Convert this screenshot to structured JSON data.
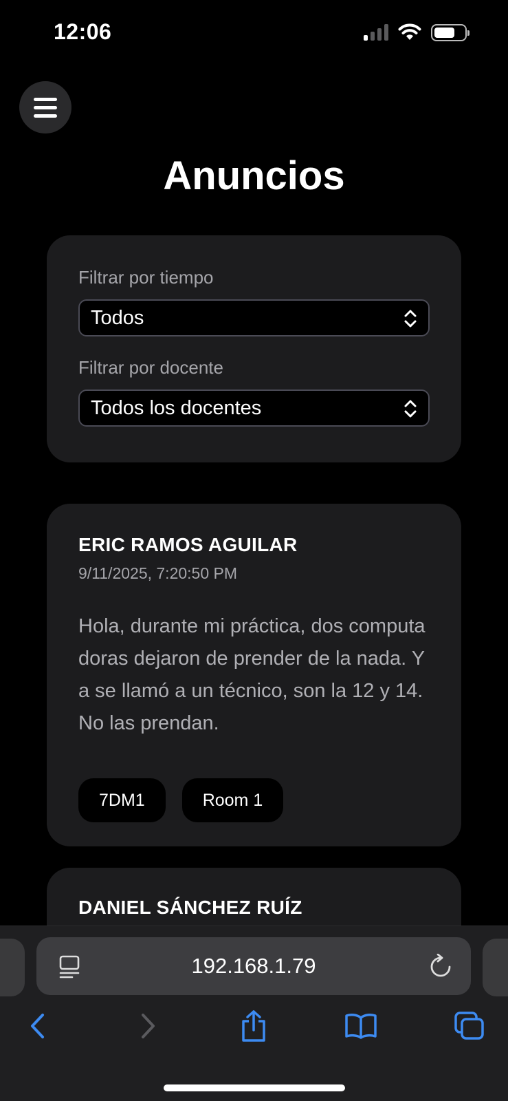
{
  "status_bar": {
    "time": "12:06"
  },
  "page": {
    "title": "Anuncios"
  },
  "filters": {
    "time_label": "Filtrar por tiempo",
    "time_value": "Todos",
    "teacher_label": "Filtrar por docente",
    "teacher_value": "Todos los docentes"
  },
  "announcements": [
    {
      "author": "ERIC RAMOS AGUILAR",
      "date": "9/11/2025, 7:20:50 PM",
      "message": "Hola, durante mi práctica, dos computadoras dejaron de prender de la nada. Ya se llamó a un técnico, son la 12 y 14. No las prendan.",
      "tags": [
        "7DM1",
        "Room 1"
      ]
    },
    {
      "author": "DANIEL SÁNCHEZ RUÍZ"
    }
  ],
  "browser": {
    "url": "192.168.1.79",
    "accent_color": "#3d8bf2"
  }
}
